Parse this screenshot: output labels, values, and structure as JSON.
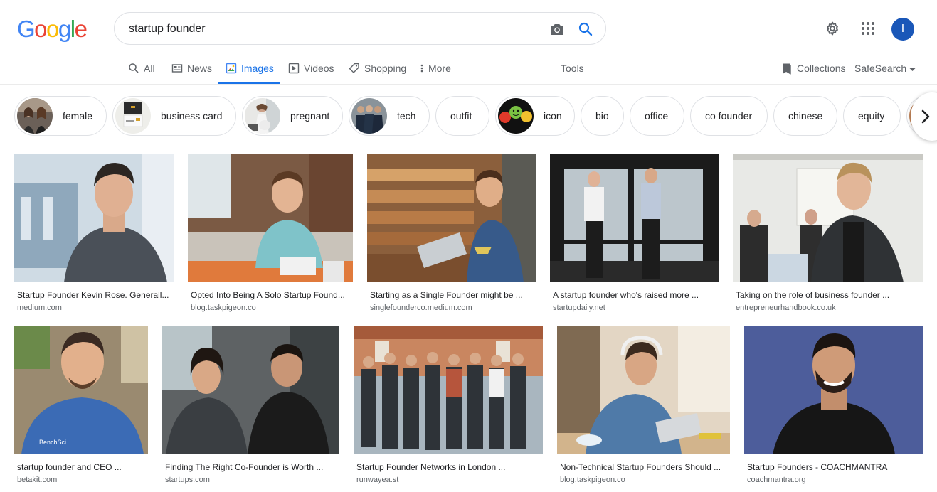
{
  "logo": {
    "letters": [
      "G",
      "o",
      "o",
      "g",
      "l",
      "e"
    ],
    "colors": [
      "#4285f4",
      "#ea4335",
      "#fbbc05",
      "#4285f4",
      "#34a853",
      "#ea4335"
    ]
  },
  "search": {
    "query": "startup founder"
  },
  "header": {
    "avatar_letter": "I"
  },
  "tabs": [
    {
      "label": "All",
      "icon": "search-icon"
    },
    {
      "label": "News",
      "icon": "news-icon"
    },
    {
      "label": "Images",
      "icon": "images-icon",
      "active": true
    },
    {
      "label": "Videos",
      "icon": "play-icon"
    },
    {
      "label": "Shopping",
      "icon": "tag-icon"
    },
    {
      "label": "More",
      "icon": "more-vert-icon"
    }
  ],
  "toolbar": {
    "tools": "Tools",
    "collections": "Collections",
    "safesearch": "SafeSearch"
  },
  "chips": [
    "female",
    "business card",
    "pregnant",
    "tech",
    "outfit",
    "icon",
    "bio",
    "office",
    "co founder",
    "chinese",
    "equity"
  ],
  "results_row1": [
    {
      "caption": "Startup Founder Kevin Rose. Generall...",
      "source": "medium.com"
    },
    {
      "caption": "Opted Into Being A Solo Startup Found...",
      "source": "blog.taskpigeon.co"
    },
    {
      "caption": "Starting as a Single Founder might be ...",
      "source": "singlefounderco.medium.com"
    },
    {
      "caption": "A startup founder who's raised more ...",
      "source": "startupdaily.net"
    },
    {
      "caption": "Taking on the role of business founder ...",
      "source": "entrepreneurhandbook.co.uk"
    }
  ],
  "results_row2": [
    {
      "caption": "startup founder and CEO ...",
      "source": "betakit.com",
      "shirt_text": "BenchSci"
    },
    {
      "caption": "Finding The Right Co-Founder is Worth ...",
      "source": "startups.com"
    },
    {
      "caption": "Startup Founder Networks in London ...",
      "source": "runwayea.st"
    },
    {
      "caption": "Non-Technical Startup Founders Should ...",
      "source": "blog.taskpigeon.co"
    },
    {
      "caption": "Startup Founders - COACHMANTRA",
      "source": "coachmantra.org"
    }
  ],
  "colors": {
    "accent": "#1a73e8",
    "avatar": "#1a57b8"
  }
}
